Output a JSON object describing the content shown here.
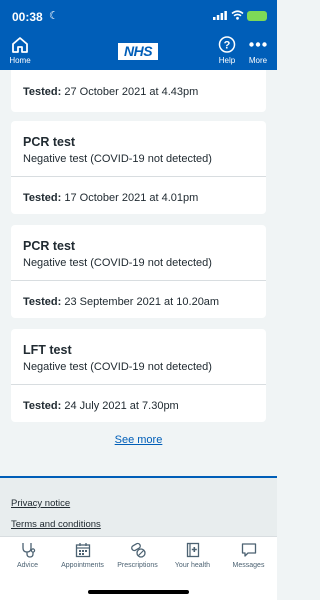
{
  "status": {
    "time": "00:38"
  },
  "header": {
    "home_label": "Home",
    "logo_text": "NHS",
    "help_label": "Help",
    "more_label": "More"
  },
  "tested_prefix": "Tested:",
  "tests": [
    {
      "tested": " 27 October 2021 at 4.43pm"
    },
    {
      "title": "PCR test",
      "result": "Negative test (COVID-19 not detected)",
      "tested": " 17 October 2021 at 4.01pm"
    },
    {
      "title": "PCR test",
      "result": "Negative test (COVID-19 not detected)",
      "tested": " 23 September 2021 at 10.20am"
    },
    {
      "title": "LFT test",
      "result": "Negative test (COVID-19 not detected)",
      "tested": " 24 July 2021 at 7.30pm"
    }
  ],
  "see_more": "See more",
  "footer": {
    "privacy": "Privacy notice",
    "terms": "Terms and conditions"
  },
  "tabs": [
    {
      "label": "Advice",
      "icon": "stethoscope-icon"
    },
    {
      "label": "Appointments",
      "icon": "calendar-icon"
    },
    {
      "label": "Prescriptions",
      "icon": "pills-icon"
    },
    {
      "label": "Your health",
      "icon": "health-record-icon"
    },
    {
      "label": "Messages",
      "icon": "message-icon"
    }
  ],
  "colors": {
    "brand": "#005eb8",
    "background": "#f0f4f5",
    "text": "#212b32",
    "tab_text": "#4c6272"
  }
}
